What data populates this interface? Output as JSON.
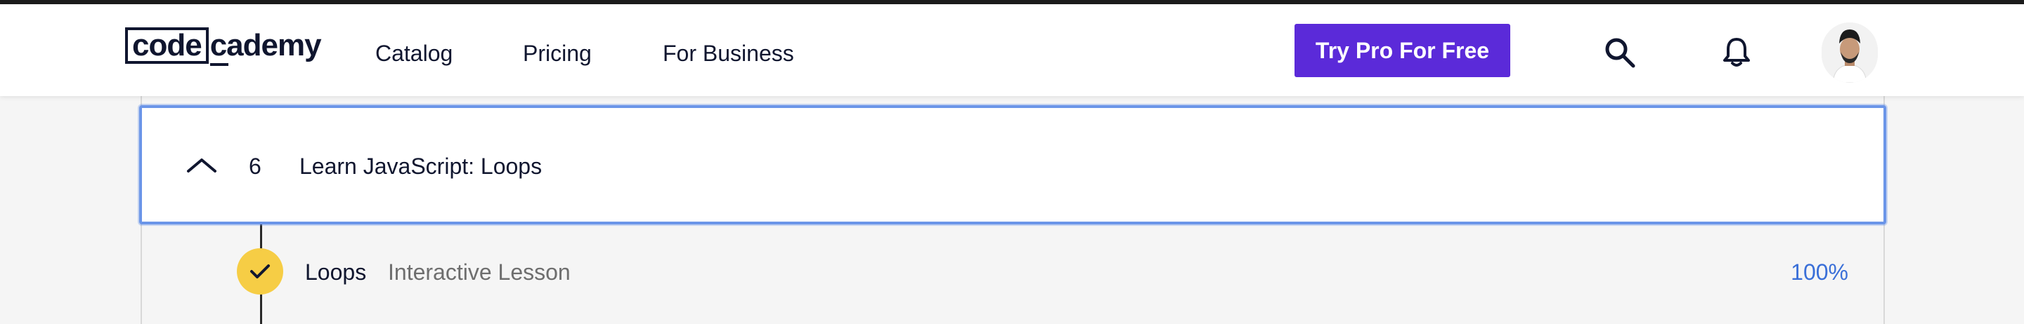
{
  "colors": {
    "brand_dark": "#10162f",
    "cta_purple": "#5b2ad9",
    "focus_blue": "#6b95e8",
    "check_yellow": "#f6cd45",
    "percent_blue": "#3a6fd8"
  },
  "header": {
    "logo_box": "code",
    "logo_rest": "cademy",
    "nav": [
      "Catalog",
      "Pricing",
      "For Business"
    ],
    "cta_label": "Try Pro For Free",
    "icons": [
      "search-icon",
      "bell-icon",
      "avatar"
    ]
  },
  "module": {
    "number": "6",
    "title": "Learn JavaScript: Loops",
    "expanded": true,
    "icon": "chevron-up-icon"
  },
  "lessons": [
    {
      "name": "Loops",
      "type": "Interactive Lesson",
      "progress": "100%",
      "completed": true,
      "icon": "checkmark-icon"
    }
  ]
}
